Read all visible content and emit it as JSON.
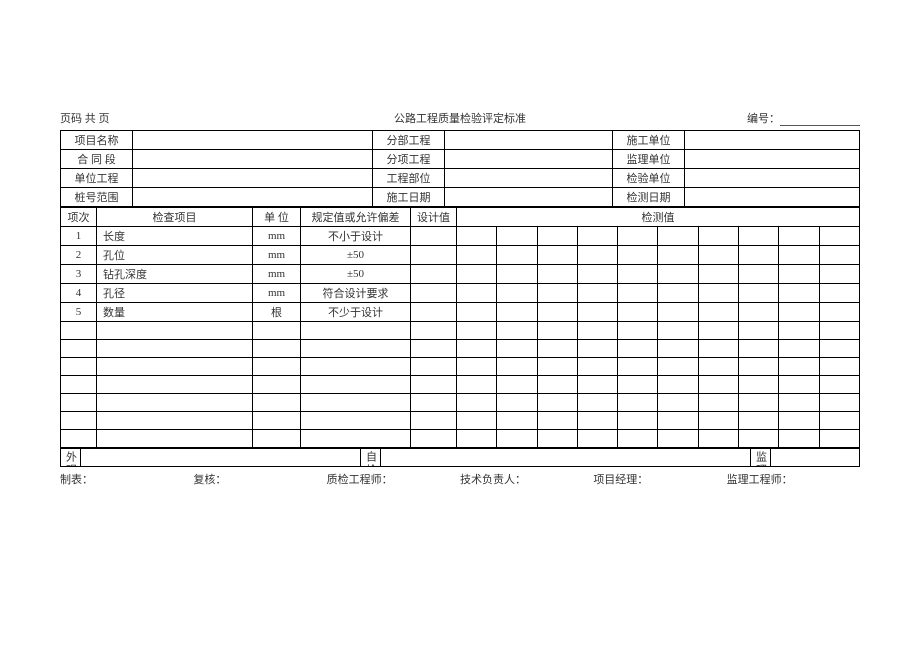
{
  "top": {
    "page_code": "页码  共  页",
    "title": "公路工程质量检验评定标准",
    "serial_label": "编号："
  },
  "header": {
    "row1": {
      "l": "项目名称",
      "m": "分部工程",
      "r": "施工单位"
    },
    "row2": {
      "l": "合 同 段",
      "m": "分项工程",
      "r": "监理单位"
    },
    "row3": {
      "l": "单位工程",
      "m": "工程部位",
      "r": "检验单位"
    },
    "row4": {
      "l": "桩号范围",
      "m": "施工日期",
      "r": "检测日期"
    }
  },
  "cols": {
    "seq": "项次",
    "item": "检查项目",
    "unit": "单 位",
    "spec": "规定值或允许偏差",
    "design": "设计值",
    "measure": "检测值"
  },
  "rows": [
    {
      "n": "1",
      "item": "长度",
      "unit": "mm",
      "spec": "不小于设计"
    },
    {
      "n": "2",
      "item": "孔位",
      "unit": "mm",
      "spec": "±50"
    },
    {
      "n": "3",
      "item": "钻孔深度",
      "unit": "mm",
      "spec": "±50"
    },
    {
      "n": "4",
      "item": "孔径",
      "unit": "mm",
      "spec": "符合设计要求"
    },
    {
      "n": "5",
      "item": "数量",
      "unit": "根",
      "spec": "不少于设计"
    },
    {
      "n": "",
      "item": "",
      "unit": "",
      "spec": ""
    },
    {
      "n": "",
      "item": "",
      "unit": "",
      "spec": ""
    },
    {
      "n": "",
      "item": "",
      "unit": "",
      "spec": ""
    },
    {
      "n": "",
      "item": "",
      "unit": "",
      "spec": ""
    },
    {
      "n": "",
      "item": "",
      "unit": "",
      "spec": ""
    },
    {
      "n": "",
      "item": "",
      "unit": "",
      "spec": ""
    },
    {
      "n": "",
      "item": "",
      "unit": "",
      "spec": ""
    }
  ],
  "bottom": {
    "appearance": "外观鉴定",
    "self_check": "自检意见",
    "supervise": "监理意见"
  },
  "footer": {
    "c1": "制表：",
    "c2": "复核：",
    "c3": "质检工程师：",
    "c4": "技术负责人：",
    "c5": "项目经理：",
    "c6": "监理工程师："
  }
}
